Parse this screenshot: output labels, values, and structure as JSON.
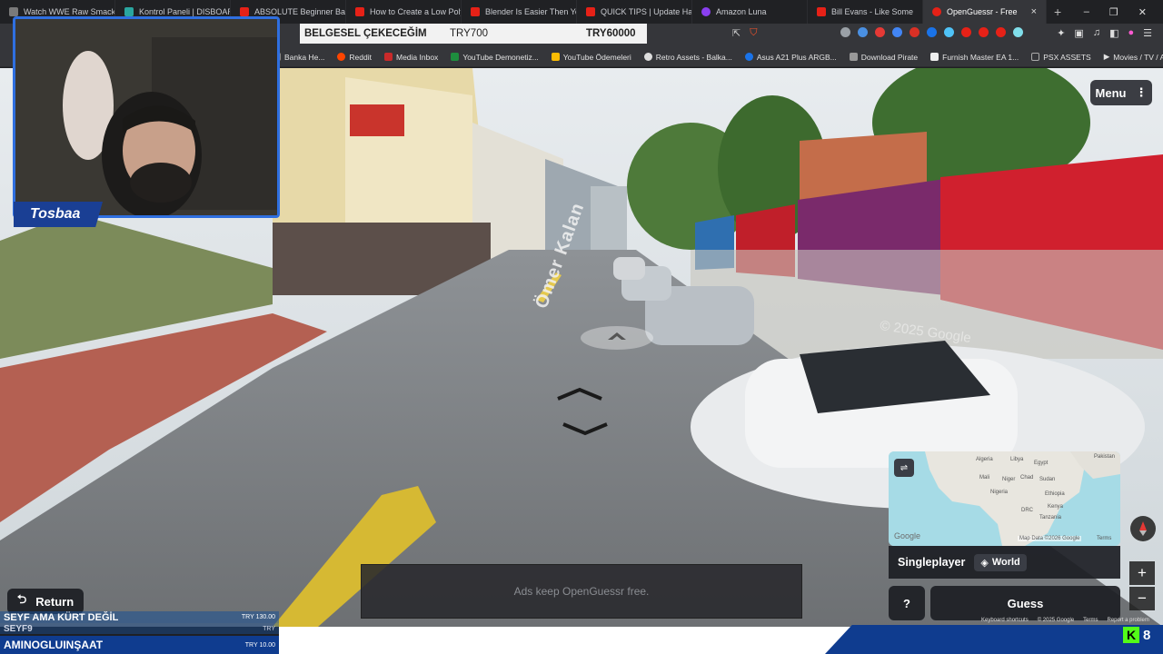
{
  "browser": {
    "tabs": [
      {
        "label": "Watch WWE Raw SmackD",
        "color": "#7a7a7a"
      },
      {
        "label": "Kontrol Paneli | DISBOARD",
        "color": "#2aa6a0"
      },
      {
        "label": "ABSOLUTE Beginner Basic",
        "color": "#e62117"
      },
      {
        "label": "How to Create a Low Poly",
        "color": "#e62117"
      },
      {
        "label": "Blender Is Easier Then Yo",
        "color": "#e62117"
      },
      {
        "label": "QUICK TIPS | Update Hand",
        "color": "#e62117"
      },
      {
        "label": "Amazon Luna",
        "color": "#8a3ff0"
      },
      {
        "label": "Bill Evans - Like Some",
        "color": "#e62117"
      },
      {
        "label": "OpenGuessr - Free",
        "color": "#e62117",
        "active": true
      }
    ],
    "new_tab": "+",
    "window_controls": [
      "–",
      "❐",
      "✕"
    ],
    "bookmarks": [
      {
        "label": "Banka He...",
        "color": "#888"
      },
      {
        "label": "Reddit",
        "color": "#ff4500"
      },
      {
        "label": "Media Inbox",
        "color": "#c92a2a"
      },
      {
        "label": "YouTube Demonetiz...",
        "color": "#1e8e3e"
      },
      {
        "label": "YouTube Ödemeleri",
        "color": "#fbbc04"
      },
      {
        "label": "Retro Assets - Balka...",
        "color": "#ddd"
      },
      {
        "label": "Asus A21 Plus ARGB...",
        "color": "#1a73e8"
      },
      {
        "label": "Download Pirate",
        "color": "#999"
      },
      {
        "label": "Furnish Master EA 1...",
        "color": "#eee"
      },
      {
        "label": "PSX ASSETS",
        "color": "#aaa"
      },
      {
        "label": "Movies / TV / Anim...",
        "color": "#ccc"
      }
    ]
  },
  "ticker": {
    "title": "BELGESEL ÇEKECEĞİM",
    "current": "TRY700",
    "goal": "TRY60000"
  },
  "stream": {
    "streamer_name": "Tosbaa"
  },
  "game": {
    "menu_label": "Menu",
    "menu_icon": "⋮",
    "street_label": "Ömer Kalan",
    "map": {
      "labels": [
        "Algeria",
        "Libya",
        "Egypt",
        "Mali",
        "Niger",
        "Chad",
        "Sudan",
        "Nigeria",
        "Ethiopia",
        "DRC",
        "Kenya",
        "Tanzania",
        "Pakistan"
      ],
      "attribution": "Map Data ©2026 Google",
      "terms": "Terms",
      "logo": "Google"
    },
    "mode": "Singleplayer",
    "region": "World",
    "help_label": "?",
    "guess_label": "Guess",
    "zoom_in": "+",
    "zoom_out": "−",
    "ads_text": "Ads keep OpenGuessr free.",
    "return_label": "Return",
    "watermark": "© 2025 Google",
    "footer": [
      "Keyboard shortcuts",
      "© 2025 Google",
      "Terms",
      "Report a problem"
    ]
  },
  "donations": [
    {
      "name": "SEYF AMA KÜRT DEĞİL",
      "amount": "TRY 130.00"
    },
    {
      "name": "SEYF9",
      "amount": "TRY"
    },
    {
      "name": "AMINOGLUINŞAAT",
      "amount": "TRY 10.00"
    }
  ],
  "kick": {
    "logo": "K",
    "count": "8"
  }
}
